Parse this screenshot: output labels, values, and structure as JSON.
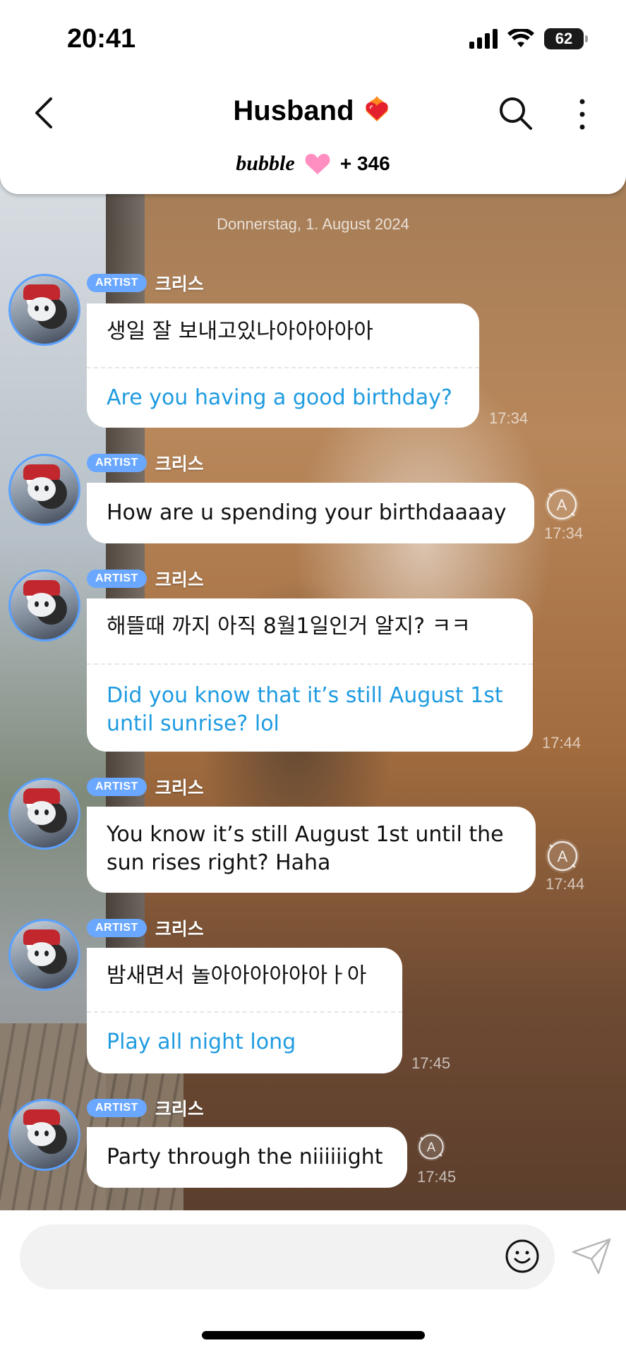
{
  "status_bar": {
    "time": "20:41",
    "battery": "62"
  },
  "header": {
    "title": "Husband",
    "brand": "bubble",
    "member_count": "+ 346"
  },
  "chat": {
    "date": "Donnerstag, 1. August 2024",
    "messages": [
      {
        "badge": "ARTIST",
        "sender": "크리스",
        "text": "생일 잘 보내고있나아아아아아",
        "translation": "Are you having a good birthday?",
        "time": "17:34"
      },
      {
        "badge": "ARTIST",
        "sender": "크리스",
        "text": "How are u spending your birthdaaaay",
        "time": "17:34"
      },
      {
        "badge": "ARTIST",
        "sender": "크리스",
        "text": "해뜰때 까지 아직 8월1일인거 알지? ㅋㅋ",
        "translation": "Did you know that it’s still August 1st until sunrise? lol",
        "time": "17:44"
      },
      {
        "badge": "ARTIST",
        "sender": "크리스",
        "text": "You know it’s still August 1st until the sun rises right? Haha",
        "time": "17:44"
      },
      {
        "badge": "ARTIST",
        "sender": "크리스",
        "text": "밤새면서 놀아아아아아아ㅏ아",
        "translation": "Play all night long",
        "time": "17:45"
      },
      {
        "badge": "ARTIST",
        "sender": "크리스",
        "text": "Party through the niiiiiight",
        "time": "17:45"
      }
    ]
  },
  "composer": {
    "placeholder": ""
  },
  "icons": {
    "back": "chevron-left-icon",
    "search": "search-icon",
    "more": "more-vertical-icon",
    "translate": "translate-icon",
    "emoji": "smiley-icon",
    "send": "send-icon"
  }
}
